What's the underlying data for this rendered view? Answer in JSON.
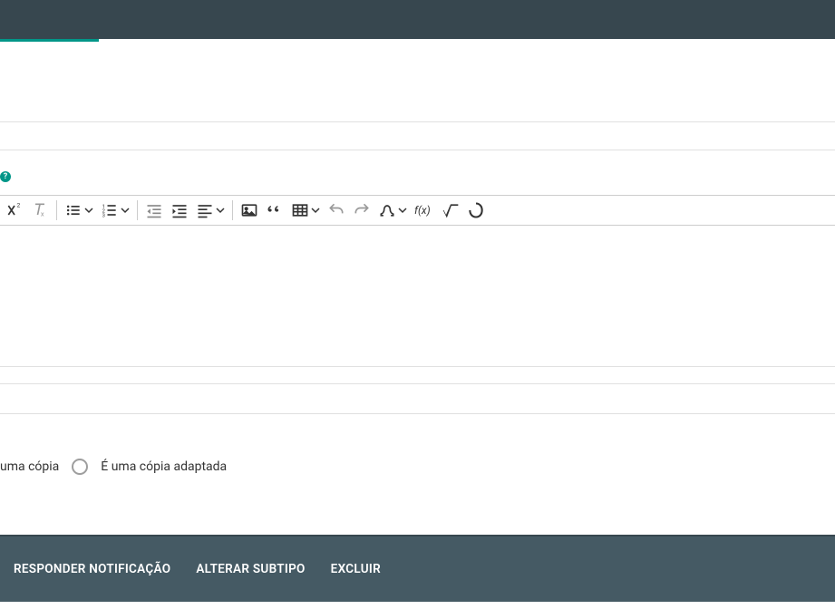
{
  "help_glyph": "?",
  "radio_options": {
    "copia": "uma cópia",
    "copia_adaptada": "É uma cópia adaptada"
  },
  "actions": {
    "responder": "RESPONDER NOTIFICAÇÃO",
    "alterar": "ALTERAR SUBTIPO",
    "excluir": "EXCLUIR"
  },
  "toolbar_icons": {
    "superscript": "superscript-icon",
    "clear_format": "clear-format-icon",
    "bullet_list": "bullet-list-icon",
    "numbered_list": "numbered-list-icon",
    "outdent": "outdent-icon",
    "indent": "indent-icon",
    "align": "align-icon",
    "image": "image-icon",
    "quote": "quote-icon",
    "table": "table-icon",
    "undo": "undo-icon",
    "redo": "redo-icon",
    "omega": "omega-icon",
    "fx": "fx-icon",
    "sqrt": "sqrt-icon",
    "custom": "custom-icon"
  }
}
